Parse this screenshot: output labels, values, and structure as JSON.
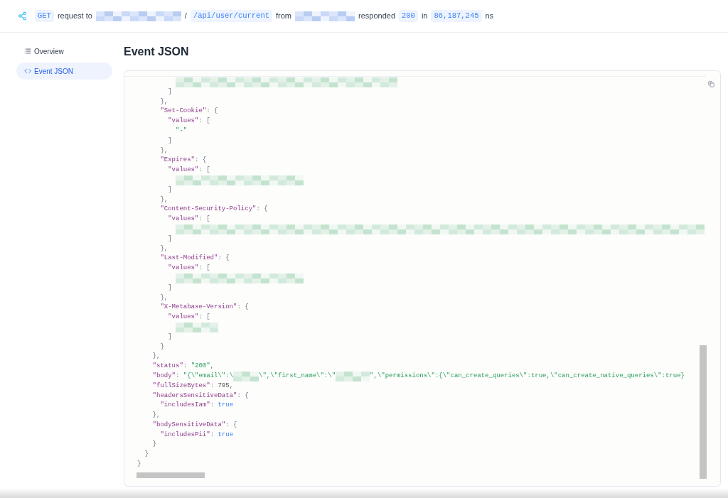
{
  "header": [
    {
      "kind": "chip",
      "text": "GET"
    },
    {
      "kind": "text",
      "text": "request to"
    },
    {
      "kind": "redacted"
    },
    {
      "kind": "text",
      "text": "/"
    },
    {
      "kind": "chip",
      "text": "/api/user/current"
    },
    {
      "kind": "text",
      "text": "from"
    },
    {
      "kind": "redacted"
    },
    {
      "kind": "text",
      "text": "responded"
    },
    {
      "kind": "chip",
      "text": "200"
    },
    {
      "kind": "text",
      "text": "in"
    },
    {
      "kind": "chip",
      "text": "86,187,245"
    },
    {
      "kind": "text",
      "text": "ns"
    }
  ],
  "sidebar": {
    "items": [
      {
        "label": "Overview",
        "selected": false
      },
      {
        "label": "Event JSON",
        "selected": true
      }
    ]
  },
  "title": "Event JSON",
  "code_lines": [
    [
      {
        "kind": "redacted"
      }
    ],
    [
      {
        "kind": "punct",
        "text": "        ]"
      }
    ],
    [
      {
        "kind": "punct",
        "text": "      },"
      }
    ],
    [
      {
        "kind": "key",
        "text": "      \"Set-Cookie\""
      },
      {
        "kind": "punct",
        "text": ": {"
      }
    ],
    [
      {
        "kind": "key",
        "text": "        \"values\""
      },
      {
        "kind": "punct",
        "text": ": ["
      }
    ],
    [
      {
        "kind": "string",
        "text": "          \"-\""
      }
    ],
    [
      {
        "kind": "punct",
        "text": "        ]"
      }
    ],
    [
      {
        "kind": "punct",
        "text": "      },"
      }
    ],
    [
      {
        "kind": "key",
        "text": "      \"Expires\""
      },
      {
        "kind": "punct",
        "text": ": {"
      }
    ],
    [
      {
        "kind": "key",
        "text": "        \"values\""
      },
      {
        "kind": "punct",
        "text": ": ["
      }
    ],
    [
      {
        "kind": "redacted"
      }
    ],
    [
      {
        "kind": "punct",
        "text": "        ]"
      }
    ],
    [
      {
        "kind": "punct",
        "text": "      },"
      }
    ],
    [
      {
        "kind": "key",
        "text": "      \"Content-Security-Policy\""
      },
      {
        "kind": "punct",
        "text": ": {"
      }
    ],
    [
      {
        "kind": "key",
        "text": "        \"values\""
      },
      {
        "kind": "punct",
        "text": ": ["
      }
    ],
    [
      {
        "kind": "redacted"
      }
    ],
    [
      {
        "kind": "punct",
        "text": "        ]"
      }
    ],
    [
      {
        "kind": "punct",
        "text": "      },"
      }
    ],
    [
      {
        "kind": "key",
        "text": "      \"Last-Modified\""
      },
      {
        "kind": "punct",
        "text": ": {"
      }
    ],
    [
      {
        "kind": "key",
        "text": "        \"values\""
      },
      {
        "kind": "punct",
        "text": ": ["
      }
    ],
    [
      {
        "kind": "redacted"
      }
    ],
    [
      {
        "kind": "punct",
        "text": "        ]"
      }
    ],
    [
      {
        "kind": "punct",
        "text": "      },"
      }
    ],
    [
      {
        "kind": "key",
        "text": "      \"X-Metabase-Version\""
      },
      {
        "kind": "punct",
        "text": ": {"
      }
    ],
    [
      {
        "kind": "key",
        "text": "        \"values\""
      },
      {
        "kind": "punct",
        "text": ": ["
      }
    ],
    [
      {
        "kind": "redacted"
      }
    ],
    [
      {
        "kind": "punct",
        "text": "        ]"
      }
    ],
    [
      {
        "kind": "punct",
        "text": "      }"
      }
    ],
    [
      {
        "kind": "punct",
        "text": "    },"
      }
    ],
    [
      {
        "kind": "key",
        "text": "    \"status\""
      },
      {
        "kind": "punct",
        "text": ": "
      },
      {
        "kind": "string",
        "text": "\"200\""
      },
      {
        "kind": "punct",
        "text": ","
      }
    ],
    [
      {
        "kind": "key",
        "text": "    \"body\""
      },
      {
        "kind": "punct",
        "text": ": "
      },
      {
        "kind": "string",
        "text": "\"{\\\"email\\\":\\"
      },
      {
        "kind": "redacted"
      },
      {
        "kind": "string",
        "text": "\\\",\\\"first_name\\\":\\\""
      },
      {
        "kind": "redacted"
      },
      {
        "kind": "string",
        "text": "\",\\\"permissions\\\":{\\\"can_create_queries\\\":true,\\\"can_create_native_queries\\\":true}"
      }
    ],
    [
      {
        "kind": "key",
        "text": "    \"fullSizeBytes\""
      },
      {
        "kind": "punct",
        "text": ": "
      },
      {
        "kind": "number",
        "text": "795"
      },
      {
        "kind": "punct",
        "text": ","
      }
    ],
    [
      {
        "kind": "key",
        "text": "    \"headersSensitiveData\""
      },
      {
        "kind": "punct",
        "text": ": {"
      }
    ],
    [
      {
        "kind": "key",
        "text": "      \"includesIam\""
      },
      {
        "kind": "punct",
        "text": ": "
      },
      {
        "kind": "bool",
        "text": "true"
      }
    ],
    [
      {
        "kind": "punct",
        "text": "    },"
      }
    ],
    [
      {
        "kind": "key",
        "text": "    \"bodySensitiveData\""
      },
      {
        "kind": "punct",
        "text": ": {"
      }
    ],
    [
      {
        "kind": "key",
        "text": "      \"includesPii\""
      },
      {
        "kind": "punct",
        "text": ": "
      },
      {
        "kind": "bool",
        "text": "true"
      }
    ],
    [
      {
        "kind": "punct",
        "text": "    }"
      }
    ],
    [
      {
        "kind": "punct",
        "text": "  }"
      }
    ],
    [
      {
        "kind": "punct",
        "text": "}"
      }
    ]
  ]
}
